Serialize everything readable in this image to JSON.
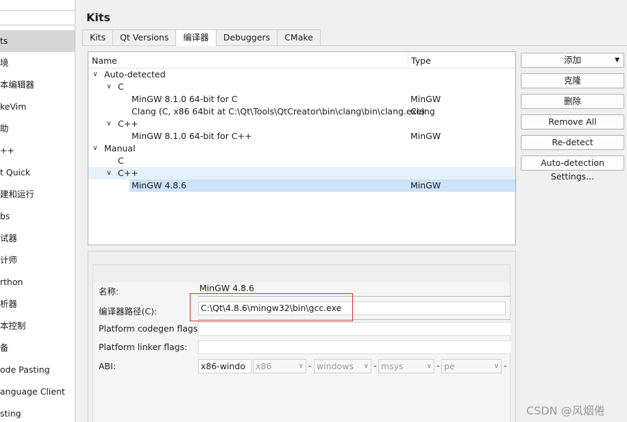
{
  "sidebar": {
    "items": [
      {
        "label": "ts"
      },
      {
        "label": "境"
      },
      {
        "label": "本编辑器"
      },
      {
        "label": "keVim"
      },
      {
        "label": "助"
      },
      {
        "label": "++"
      },
      {
        "label": "t Quick"
      },
      {
        "label": "建和运行"
      },
      {
        "label": "bs"
      },
      {
        "label": "试器"
      },
      {
        "label": "计师"
      },
      {
        "label": "rthon"
      },
      {
        "label": "析器"
      },
      {
        "label": "本控制"
      },
      {
        "label": "备"
      },
      {
        "label": "ode Pasting"
      },
      {
        "label": "anguage Client"
      },
      {
        "label": "sting"
      }
    ]
  },
  "page": {
    "title": "Kits"
  },
  "tabs": [
    {
      "label": "Kits"
    },
    {
      "label": "Qt Versions"
    },
    {
      "label": "编译器"
    },
    {
      "label": "Debuggers"
    },
    {
      "label": "CMake"
    }
  ],
  "tree": {
    "col_name": "Name",
    "col_type": "Type",
    "rows": [
      {
        "name": "Auto-detected",
        "type": "",
        "chev": "∨"
      },
      {
        "name": "C",
        "type": "",
        "chev": "∨"
      },
      {
        "name": "MinGW 8.1.0 64-bit for C",
        "type": "MinGW",
        "chev": ""
      },
      {
        "name": "Clang (C, x86 64bit at C:\\Qt\\Tools\\QtCreator\\bin\\clang\\bin\\clang.exe)",
        "type": "Clang",
        "chev": ""
      },
      {
        "name": "C++",
        "type": "",
        "chev": "∨"
      },
      {
        "name": "MinGW 8.1.0 64-bit for C++",
        "type": "MinGW",
        "chev": ""
      },
      {
        "name": "Manual",
        "type": "",
        "chev": "∨"
      },
      {
        "name": "C",
        "type": "",
        "chev": ""
      },
      {
        "name": "C++",
        "type": "",
        "chev": "∨"
      },
      {
        "name": "MinGW 4.8.6",
        "type": "MinGW",
        "chev": ""
      }
    ]
  },
  "buttons": {
    "add": "添加",
    "clone": "克隆",
    "remove": "删除",
    "remove_all": "Remove All",
    "redetect": "Re-detect",
    "auto_settings": "Auto-detection Settings..."
  },
  "details": {
    "name_label": "名称:",
    "name_value": "MinGW 4.8.6",
    "path_label": "编译器路径(C):",
    "path_value": "C:\\Qt\\4.8.6\\mingw32\\bin\\gcc.exe",
    "codegen_label": "Platform codegen flags:",
    "linker_label": "Platform linker flags:",
    "abi_label": "ABI:",
    "abi": [
      "x86-windo",
      "x86",
      "windows",
      "msys",
      "pe"
    ]
  },
  "watermark": "CSDN @风烟倦",
  "colors": {
    "selection": "#cde3f7",
    "highlight_row": "#e6f0fa",
    "annotation_red": "#d9272e"
  }
}
